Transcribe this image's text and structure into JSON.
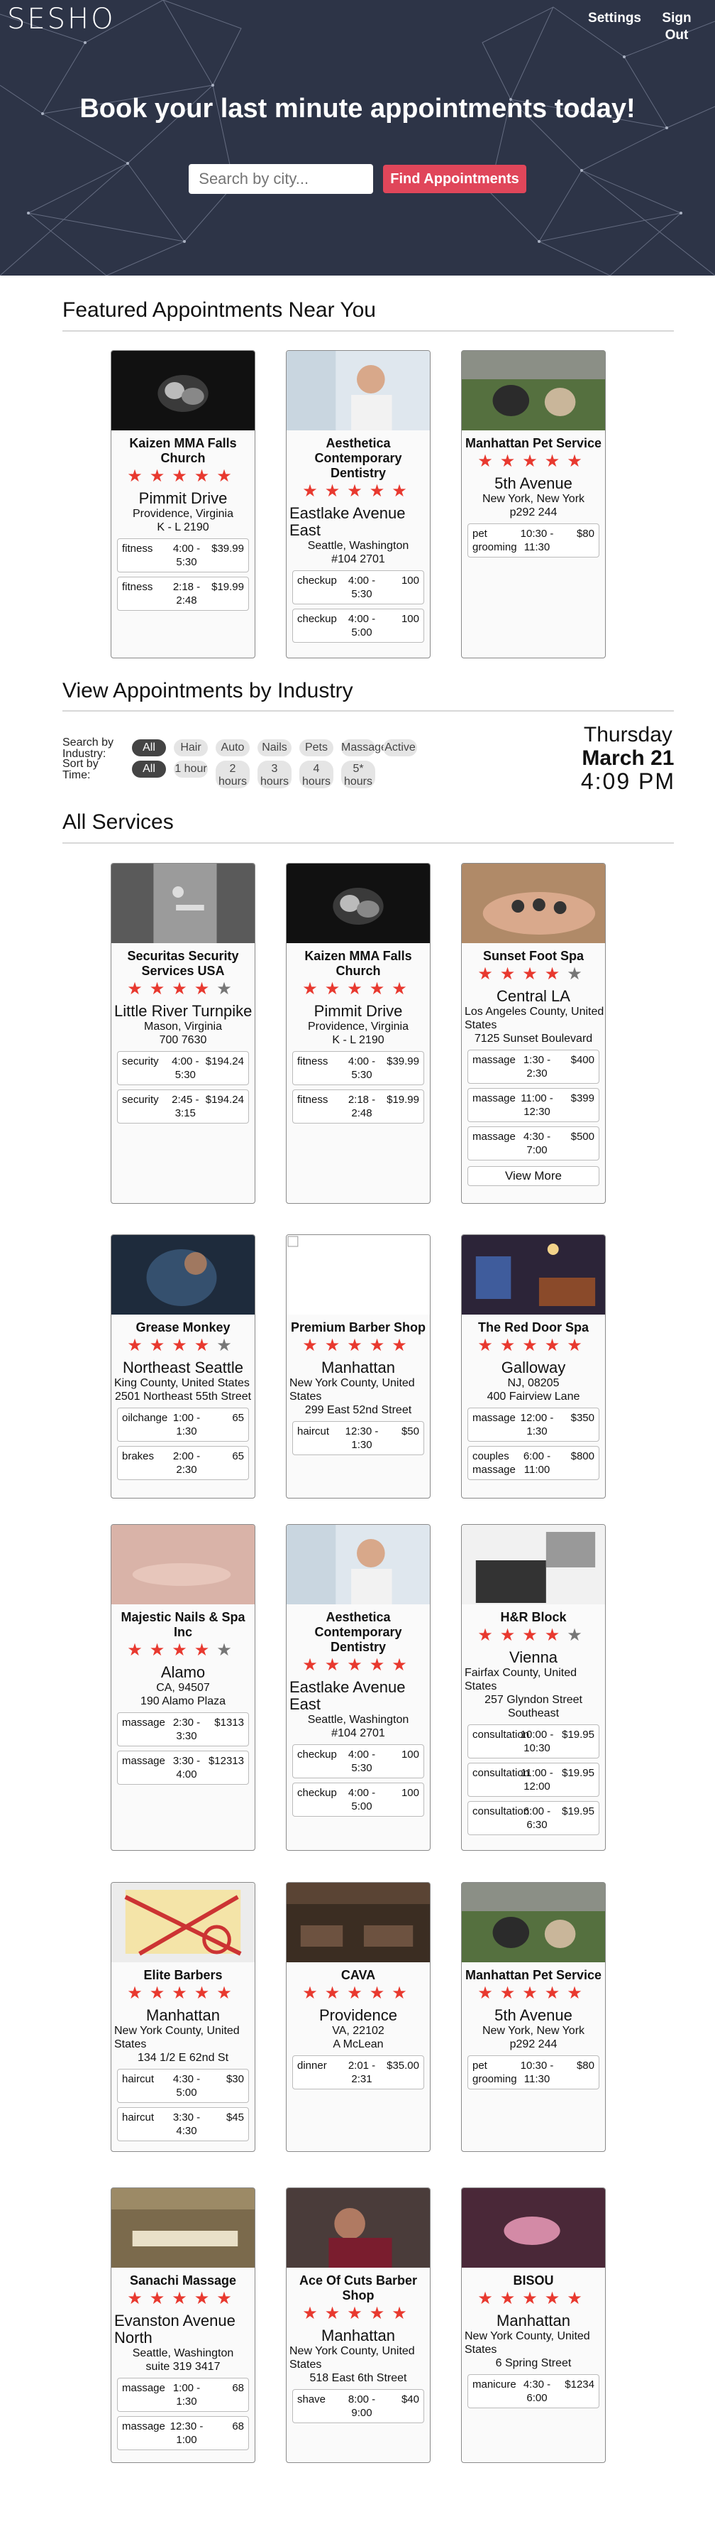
{
  "header": {
    "logo": "SESHO",
    "nav": [
      "Settings",
      "Sign Out"
    ],
    "hero_title": "Book your last minute appointments today!",
    "search_placeholder": "Search by city...",
    "search_button": "Find Appointments"
  },
  "featured": {
    "title": "Featured Appointments Near You",
    "cards": [
      {
        "name": "Kaizen MMA Falls Church",
        "stars": 5,
        "addr1": "Pimmit Drive",
        "addr2": "Providence, Virginia",
        "addr3": "K - L 2190",
        "services": [
          {
            "type": "fitness",
            "time": "4:00 - 5:30",
            "price": "$39.99"
          },
          {
            "type": "fitness",
            "time": "2:18 - 2:48",
            "price": "$19.99"
          }
        ]
      },
      {
        "name": "Aesthetica Contemporary Dentistry",
        "stars": 5,
        "addr1": "Eastlake Avenue East",
        "addr2": "Seattle, Washington",
        "addr3": "#104 2701",
        "services": [
          {
            "type": "checkup",
            "time": "4:00 - 5:30",
            "price": "100"
          },
          {
            "type": "checkup",
            "time": "4:00 - 5:00",
            "price": "100"
          }
        ]
      },
      {
        "name": "Manhattan Pet Service",
        "stars": 5,
        "addr1": "5th Avenue",
        "addr2": "New York, New York",
        "addr3": "p292 244",
        "services": [
          {
            "type": "pet grooming",
            "time": "10:30 - 11:30",
            "price": "$80"
          }
        ]
      }
    ]
  },
  "industry": {
    "title": "View Appointments by Industry",
    "industry_label": "Search by Industry:",
    "time_label": "Sort by Time:",
    "industry_pills": [
      "All",
      "Hair",
      "Auto",
      "Nails",
      "Pets",
      "Massage",
      "Active"
    ],
    "time_pills": [
      "All",
      "1 hour",
      "2 hours",
      "3 hours",
      "4 hours",
      "5* hours"
    ],
    "day": "Thursday",
    "date": "March 21",
    "clock": "4:09 PM"
  },
  "all": {
    "title": "All Services",
    "cards": [
      {
        "name": "Securitas Security Services USA",
        "stars": 4,
        "addr1": "Little River Turnpike",
        "addr2": "Mason, Virginia",
        "addr3": "700 7630",
        "services": [
          {
            "type": "security",
            "time": "4:00 - 5:30",
            "price": "$194.24"
          },
          {
            "type": "security",
            "time": "2:45 - 3:15",
            "price": "$194.24"
          }
        ]
      },
      {
        "name": "Kaizen MMA Falls Church",
        "stars": 5,
        "addr1": "Pimmit Drive",
        "addr2": "Providence, Virginia",
        "addr3": "K - L 2190",
        "services": [
          {
            "type": "fitness",
            "time": "4:00 - 5:30",
            "price": "$39.99"
          },
          {
            "type": "fitness",
            "time": "2:18 - 2:48",
            "price": "$19.99"
          }
        ]
      },
      {
        "name": "Sunset Foot Spa",
        "stars": 4,
        "addr1": "Central LA",
        "addr2": "Los Angeles County, United States",
        "addr3": "7125 Sunset Boulevard",
        "services": [
          {
            "type": "massage",
            "time": "1:30 - 2:30",
            "price": "$400"
          },
          {
            "type": "massage",
            "time": "11:00 - 12:30",
            "price": "$399"
          },
          {
            "type": "massage",
            "time": "4:30 - 7:00",
            "price": "$500"
          }
        ],
        "more": "View More"
      },
      {
        "name": "Grease Monkey",
        "stars": 4,
        "addr1": "Northeast Seattle",
        "addr2": "King County, United States",
        "addr3": "2501 Northeast 55th Street",
        "services": [
          {
            "type": "oilchange",
            "time": "1:00 - 1:30",
            "price": "65"
          },
          {
            "type": "brakes",
            "time": "2:00 - 2:30",
            "price": "65"
          }
        ]
      },
      {
        "name": "Premium Barber Shop",
        "stars": 5,
        "addr1": "Manhattan",
        "addr2": "New York County, United States",
        "addr3": "299 East 52nd Street",
        "services": [
          {
            "type": "haircut",
            "time": "12:30 - 1:30",
            "price": "$50"
          }
        ]
      },
      {
        "name": "The Red Door Spa",
        "stars": 5,
        "addr1": "Galloway",
        "addr2": "NJ, 08205",
        "addr3": "400 Fairview Lane",
        "services": [
          {
            "type": "massage",
            "time": "12:00 - 1:30",
            "price": "$350"
          },
          {
            "type": "couples massage",
            "time": "6:00 - 11:00",
            "price": "$800"
          }
        ]
      },
      {
        "name": "Majestic Nails & Spa Inc",
        "stars": 4,
        "addr1": "Alamo",
        "addr2": "CA, 94507",
        "addr3": "190 Alamo Plaza",
        "services": [
          {
            "type": "massage",
            "time": "2:30 - 3:30",
            "price": "$1313"
          },
          {
            "type": "massage",
            "time": "3:30 - 4:00",
            "price": "$12313"
          }
        ]
      },
      {
        "name": "Aesthetica Contemporary Dentistry",
        "stars": 5,
        "addr1": "Eastlake Avenue East",
        "addr2": "Seattle, Washington",
        "addr3": "#104 2701",
        "services": [
          {
            "type": "checkup",
            "time": "4:00 - 5:30",
            "price": "100"
          },
          {
            "type": "checkup",
            "time": "4:00 - 5:00",
            "price": "100"
          }
        ]
      },
      {
        "name": "H&R Block",
        "stars": 4,
        "addr1": "Vienna",
        "addr2": "Fairfax County, United States",
        "addr3": "257 Glyndon Street Southeast",
        "services": [
          {
            "type": "consultation",
            "time": "10:00 - 10:30",
            "price": "$19.95"
          },
          {
            "type": "consultation",
            "time": "11:00 - 12:00",
            "price": "$19.95"
          },
          {
            "type": "consultation",
            "time": "6:00 - 6:30",
            "price": "$19.95"
          }
        ]
      },
      {
        "name": "Elite Barbers",
        "stars": 5,
        "addr1": "Manhattan",
        "addr2": "New York County, United States",
        "addr3": "134 1/2 E 62nd St",
        "services": [
          {
            "type": "haircut",
            "time": "4:30 - 5:00",
            "price": "$30"
          },
          {
            "type": "haircut",
            "time": "3:30 - 4:30",
            "price": "$45"
          }
        ]
      },
      {
        "name": "CAVA",
        "stars": 5,
        "addr1": "Providence",
        "addr2": "VA, 22102",
        "addr3": "A McLean",
        "services": [
          {
            "type": "dinner",
            "time": "2:01 - 2:31",
            "price": "$35.00"
          }
        ]
      },
      {
        "name": "Manhattan Pet Service",
        "stars": 5,
        "addr1": "5th Avenue",
        "addr2": "New York, New York",
        "addr3": "p292 244",
        "services": [
          {
            "type": "pet grooming",
            "time": "10:30 - 11:30",
            "price": "$80"
          }
        ]
      },
      {
        "name": "Sanachi Massage",
        "stars": 5,
        "addr1": "Evanston Avenue North",
        "addr2": "Seattle, Washington",
        "addr3": "suite 319 3417",
        "services": [
          {
            "type": "massage",
            "time": "1:00 - 1:30",
            "price": "68"
          },
          {
            "type": "massage",
            "time": "12:30 - 1:00",
            "price": "68"
          }
        ]
      },
      {
        "name": "Ace Of Cuts Barber Shop",
        "stars": 5,
        "addr1": "Manhattan",
        "addr2": "New York County, United States",
        "addr3": "518 East 6th Street",
        "services": [
          {
            "type": "shave",
            "time": "8:00 - 9:00",
            "price": "$40"
          }
        ]
      },
      {
        "name": "BISOU",
        "stars": 5,
        "addr1": "Manhattan",
        "addr2": "New York County, United States",
        "addr3": "6 Spring Street",
        "services": [
          {
            "type": "manicure",
            "time": "4:30 - 6:00",
            "price": "$1234"
          }
        ]
      }
    ]
  },
  "colors": {
    "hero_bg": "#2d3447",
    "accent": "#e0465a",
    "star": "#e8392f"
  }
}
